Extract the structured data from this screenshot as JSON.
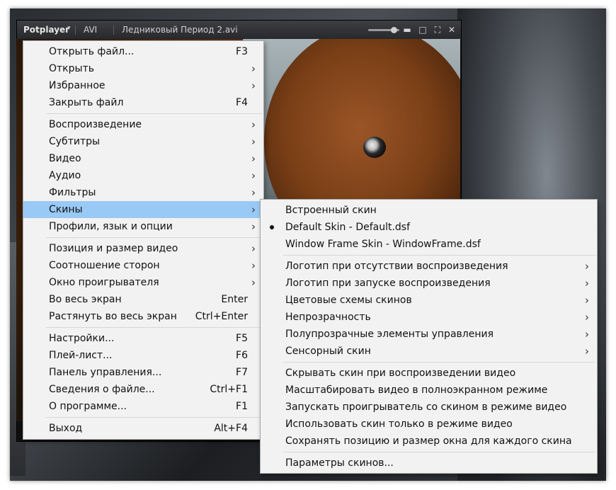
{
  "window": {
    "brand": "Potplayer",
    "brand_caret": "▾",
    "format": "AVI",
    "filename": "Ледниковый Период 2.avi",
    "buttons": {
      "minimize": "▬",
      "restore": "□",
      "fullscreen": "⛶",
      "close": "✕"
    }
  },
  "main_menu": {
    "items": [
      {
        "label": "Открыть файл...",
        "accel": "F3"
      },
      {
        "label": "Открыть",
        "arrow": "›"
      },
      {
        "label": "Избранное",
        "arrow": "›"
      },
      {
        "label": "Закрыть файл",
        "accel": "F4"
      },
      {
        "label": "Воспроизведение",
        "arrow": "›"
      },
      {
        "label": "Субтитры",
        "arrow": "›"
      },
      {
        "label": "Видео",
        "arrow": "›"
      },
      {
        "label": "Аудио",
        "arrow": "›"
      },
      {
        "label": "Фильтры",
        "arrow": "›"
      },
      {
        "label": "Скины",
        "arrow": "›",
        "highlighted": true
      },
      {
        "label": "Профили, язык и опции",
        "arrow": "›"
      },
      {
        "label": "Позиция и размер видео",
        "arrow": "›"
      },
      {
        "label": "Соотношение сторон",
        "arrow": "›"
      },
      {
        "label": "Окно проигрывателя",
        "arrow": "›"
      },
      {
        "label": "Во весь экран",
        "accel": "Enter"
      },
      {
        "label": "Растянуть во весь экран",
        "accel": "Ctrl+Enter"
      },
      {
        "label": "Настройки...",
        "accel": "F5"
      },
      {
        "label": "Плей-лист...",
        "accel": "F6"
      },
      {
        "label": "Панель управления...",
        "accel": "F7"
      },
      {
        "label": "Сведения о файле...",
        "accel": "Ctrl+F1"
      },
      {
        "label": "О программе...",
        "accel": "F1"
      },
      {
        "label": "Выход",
        "accel": "Alt+F4"
      }
    ]
  },
  "skin_menu": {
    "items": [
      {
        "label": "Встроенный скин"
      },
      {
        "label": "Default Skin - Default.dsf",
        "checked": true
      },
      {
        "label": "Window Frame Skin - WindowFrame.dsf"
      },
      {
        "label": "Логотип при отсутствии воспроизведения",
        "arrow": "›"
      },
      {
        "label": "Логотип при запуске воспроизведения",
        "arrow": "›"
      },
      {
        "label": "Цветовые схемы скинов",
        "arrow": "›"
      },
      {
        "label": "Непрозрачность",
        "arrow": "›"
      },
      {
        "label": "Полупрозрачные элементы управления",
        "arrow": "›"
      },
      {
        "label": "Сенсорный скин",
        "arrow": "›"
      },
      {
        "label": "Скрывать скин при воспроизведении видео"
      },
      {
        "label": "Масштабировать видео в полноэкранном режиме"
      },
      {
        "label": "Запускать проигрыватель со скином в режиме видео"
      },
      {
        "label": "Использовать скин только в режиме видео"
      },
      {
        "label": "Сохранять позицию и размер окна для каждого скина"
      },
      {
        "label": "Параметры скинов..."
      }
    ]
  },
  "colors": {
    "highlight": "#99c9f5",
    "menu_bg": "#f2f2f2",
    "titlebar": "#2f3134"
  }
}
